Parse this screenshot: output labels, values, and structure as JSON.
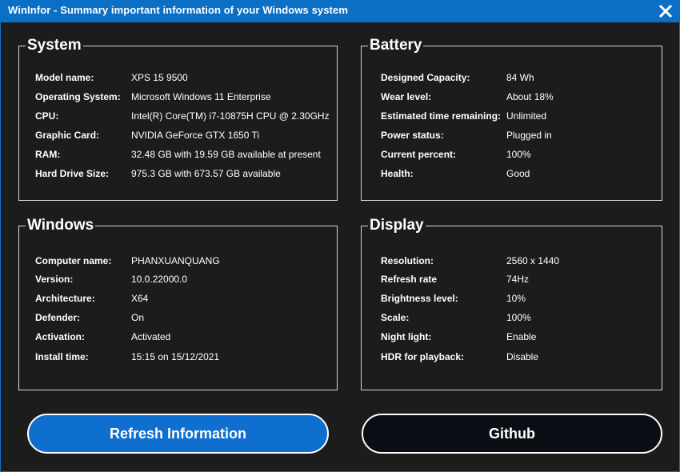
{
  "window": {
    "title": "WinInfor - Summary important information of your Windows system"
  },
  "system": {
    "title": "System",
    "rows": [
      {
        "label": "Model name:",
        "value": "XPS 15 9500"
      },
      {
        "label": "Operating System:",
        "value": "Microsoft Windows 11 Enterprise"
      },
      {
        "label": "CPU:",
        "value": "Intel(R) Core(TM) i7-10875H CPU @ 2.30GHz"
      },
      {
        "label": "Graphic Card:",
        "value": "NVIDIA GeForce GTX 1650 Ti"
      },
      {
        "label": "RAM:",
        "value": "32.48 GB with 19.59 GB available at present"
      },
      {
        "label": "Hard Drive Size:",
        "value": "975.3 GB with 673.57 GB available"
      }
    ]
  },
  "battery": {
    "title": "Battery",
    "rows": [
      {
        "label": "Designed Capacity:",
        "value": "84 Wh"
      },
      {
        "label": "Wear level:",
        "value": "About 18%"
      },
      {
        "label": "Estimated time remaining:",
        "value": "Unlimited"
      },
      {
        "label": "Power status:",
        "value": "Plugged in"
      },
      {
        "label": "Current percent:",
        "value": "100%"
      },
      {
        "label": "Health:",
        "value": "Good"
      }
    ]
  },
  "windows": {
    "title": "Windows",
    "rows": [
      {
        "label": "Computer name:",
        "value": "PHANXUANQUANG"
      },
      {
        "label": "Version:",
        "value": "10.0.22000.0"
      },
      {
        "label": "Architecture:",
        "value": "X64"
      },
      {
        "label": "Defender:",
        "value": "On"
      },
      {
        "label": "Activation:",
        "value": "Activated"
      },
      {
        "label": "Install time:",
        "value": "15:15  on 15/12/2021"
      }
    ]
  },
  "display": {
    "title": "Display",
    "rows": [
      {
        "label": "Resolution:",
        "value": "2560  x 1440"
      },
      {
        "label": "Refresh rate",
        "value": "74Hz"
      },
      {
        "label": "Brightness level:",
        "value": "10%"
      },
      {
        "label": "Scale:",
        "value": "100%"
      },
      {
        "label": "Night light:",
        "value": "Enable"
      },
      {
        "label": "HDR for playback:",
        "value": "Disable"
      }
    ]
  },
  "buttons": {
    "refresh_label": "Refresh Information",
    "github_label": "Github"
  },
  "colors": {
    "title_bar": "#0b6fc6",
    "background": "#1c1c1c",
    "refresh_button": "#0e6fcf",
    "github_button": "#0a0d13",
    "text": "#ffffff"
  }
}
